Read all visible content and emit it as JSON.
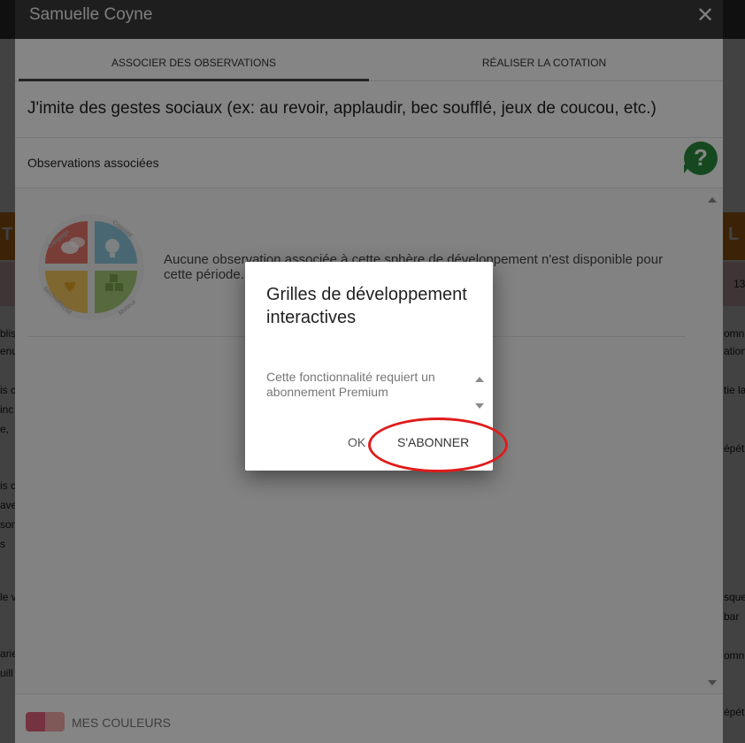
{
  "background": {
    "band_orange_left_text": "T",
    "band_orange_right_text": "L",
    "band_pink_right_text": "13",
    "left_snippets": [
      "blis",
      "enu",
      "is c",
      "inc",
      "e,",
      "is c",
      "ave",
      "son",
      "s",
      "le v",
      "arie",
      "uill"
    ],
    "right_snippets": [
      "omn",
      "ation,",
      "tie la",
      "épét",
      "sque",
      "bar",
      "omn",
      "épét"
    ]
  },
  "dialog": {
    "title": "Samuelle Coyne",
    "close_glyph": "✕",
    "tabs": [
      {
        "label": "ASSOCIER DES OBSERVATIONS",
        "active": true
      },
      {
        "label": "RÉALISER LA COTATION",
        "active": false
      }
    ],
    "criterion": "J'imite des gestes sociaux (ex: au revoir, applaudir, bec soufflé, jeux de coucou, etc.)",
    "observations_label": "Observations associées",
    "help_glyph": "?",
    "empty_message": "Aucune observation associée à cette sphère de développement n'est disponible pour cette période.",
    "wheel_labels": [
      "Langage",
      "Cognitif",
      "Socioaffectif",
      "Moteur"
    ],
    "wheel_colors": [
      "#e8756a",
      "#8cc6dc",
      "#f2c55e",
      "#a8c97a"
    ],
    "footer_label": "MES COULEURS",
    "footer_colors": [
      "#e0627a",
      "#f4a9a9"
    ]
  },
  "alert": {
    "title": "Grilles de développement interactives",
    "body": "Cette fonctionnalité requiert un abonnement Premium",
    "ok_label": "OK",
    "subscribe_label": "S'ABONNER"
  },
  "annotation": {
    "color": "#e01b1b",
    "shape": "ellipse",
    "target": "subscribe-button"
  }
}
